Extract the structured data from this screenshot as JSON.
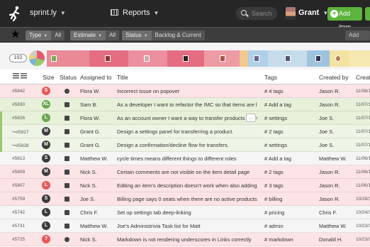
{
  "topbar": {
    "brand": "sprint.ly",
    "reports": "Reports",
    "search_placeholder": "Search",
    "user": "Grant",
    "add_item": "Add item"
  },
  "filters": [
    {
      "label": "Type",
      "value": "All"
    },
    {
      "label": "Estimate",
      "value": "All"
    },
    {
      "label": "Status",
      "value": "Backlog & Current"
    }
  ],
  "add_filter": "Add filter",
  "strip": {
    "count": "102"
  },
  "columns": {
    "size": "Size",
    "status": "Status",
    "assigned": "Assigned to",
    "title": "Title",
    "tags": "Tags",
    "created_by": "Created by",
    "created": "Created"
  },
  "rows": [
    {
      "id": "#5842",
      "size": "S",
      "status_icon": "gear-icon",
      "assigned": "Flora W.",
      "title": "Incorrect issue on popover",
      "tags": "# 4 tags",
      "created_by": "Jason R.",
      "date": "11/08/1",
      "bg": "#fce3e6",
      "circle": "c-red",
      "ellipsis": ""
    },
    {
      "id": "#5830",
      "size": "XL",
      "status_icon": "folder-icon",
      "assigned": "Sam B.",
      "title": "As a  developer  I want  to refactor the IMC  so that  items are loaded...",
      "tags": "# Add a tag",
      "created_by": "Jason R.",
      "date": "11/07/1",
      "bg": "#e7f1da",
      "circle": "c-green",
      "ellipsis": ""
    },
    {
      "id": "#5826",
      "size": "L",
      "status_icon": "folder-icon",
      "assigned": "Flora W.",
      "title": "As an  account owner  I want  a way to transfer products  so that  I c...",
      "tags": "# settings",
      "created_by": "Joe S.",
      "date": "11/07/1",
      "bg": "#e7f1da",
      "circle": "c-green",
      "ellipsis": "..."
    },
    {
      "id": "↪#5827",
      "size": "M",
      "status_icon": "folder-icon",
      "assigned": "Grant G.",
      "title": "Design a settings panel for transferring a product.",
      "tags": "# 2 tags",
      "created_by": "Joe S.",
      "date": "11/07/1",
      "bg": "#eef5e6",
      "circle": "c-dark",
      "ellipsis": ""
    },
    {
      "id": "↪#5828",
      "size": "M",
      "status_icon": "folder-icon",
      "assigned": "Grant G.",
      "title": "Design a confirmation/decline flow for transfers.",
      "tags": "# settings",
      "created_by": "Joe S.",
      "date": "11/07/1",
      "bg": "#eef5e6",
      "circle": "c-dark",
      "ellipsis": ""
    },
    {
      "id": "#5813",
      "size": "S",
      "status_icon": "folder-icon",
      "assigned": "Matthew W.",
      "title": "cycle times means different things to different roles",
      "tags": "# Add a tag",
      "created_by": "Matthew W.",
      "date": "11/06/1",
      "bg": "#f5f5f5",
      "circle": "c-dark",
      "ellipsis": ""
    },
    {
      "id": "#5809",
      "size": "M",
      "status_icon": "folder-icon",
      "assigned": "Nick S.",
      "title": "Certain comments are not visible on the item detail page",
      "tags": "# 2 tags",
      "created_by": "Jason R.",
      "date": "11/06/1",
      "bg": "#fce3e6",
      "circle": "c-dark",
      "ellipsis": ""
    },
    {
      "id": "#5807",
      "size": "L",
      "status_icon": "folder-icon",
      "assigned": "Nick S.",
      "title": "Editing an item's description doesn't work when also adding tags",
      "tags": "# 3 tags",
      "created_by": "Jason R.",
      "date": "11/06/1",
      "bg": "#fce3e6",
      "circle": "c-red",
      "ellipsis": ""
    },
    {
      "id": "#5759",
      "size": "S",
      "status_icon": "folder-icon",
      "assigned": "Joe S.",
      "title": "Billing page says 0 seats when there are no active products",
      "tags": "# billing",
      "created_by": "Jason R.",
      "date": "10/28/1",
      "bg": "#fce3e6",
      "circle": "c-dark",
      "ellipsis": ""
    },
    {
      "id": "#5742",
      "size": "L",
      "status_icon": "folder-icon",
      "assigned": "Chris F.",
      "title": "Set up settings tab deep-linking",
      "tags": "# pricing",
      "created_by": "Chris F.",
      "date": "10/24/1",
      "bg": "#f5f5f5",
      "circle": "c-dark",
      "ellipsis": ""
    },
    {
      "id": "#5731",
      "size": "L",
      "status_icon": "folder-icon",
      "assigned": "Matthew W.",
      "title": "Joe's Administrivia Task list for Matt",
      "tags": "# admin",
      "created_by": "Matthew W.",
      "date": "10/23/1",
      "bg": "#f5f5f5",
      "circle": "c-dark",
      "ellipsis": ""
    },
    {
      "id": "#5725",
      "size": "?",
      "status_icon": "gear-icon",
      "assigned": "Nick S.",
      "title": "Markdown is not rendering underscores in Links correctly",
      "tags": "# markdown",
      "created_by": "Donald H.",
      "date": "10/23/1",
      "bg": "#fce3e6",
      "circle": "c-red",
      "ellipsis": ""
    }
  ],
  "colors": {
    "accent_green": "#5cb33d",
    "bug_red": "#e55a5a",
    "story_green": "#6aa84f"
  }
}
